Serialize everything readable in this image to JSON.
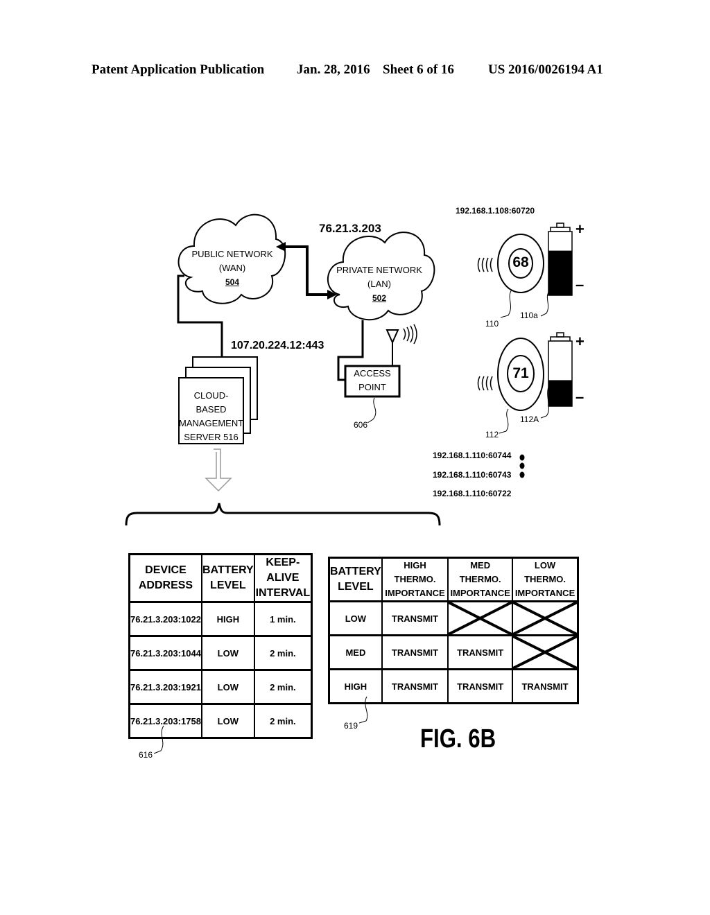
{
  "header": {
    "publication": "Patent Application Publication",
    "date": "Jan. 28, 2016",
    "sheet": "Sheet 6 of 16",
    "number": "US 2016/0026194 A1"
  },
  "diagram": {
    "public_network": {
      "line1": "PUBLIC NETWORK",
      "line2": "(WAN)",
      "ref": "504"
    },
    "private_network": {
      "line1": "PRIVATE NETWORK",
      "line2": "(LAN)",
      "ref": "502",
      "ip": "76.21.3.203"
    },
    "server": {
      "line1": "CLOUD-BASED",
      "line2": "MANAGEMENT",
      "line3": "SERVER 516",
      "ip": "107.20.224.12:443"
    },
    "access_point": {
      "line1": "ACCESS",
      "line2": "POINT",
      "ref": "606"
    },
    "thermostats": [
      {
        "address": "192.168.1.108:60720",
        "temperature": "68",
        "ref": "110",
        "battery_ref": "110a",
        "battery_level": 0.7
      },
      {
        "address": "",
        "temperature": "71",
        "ref": "112",
        "battery_ref": "112A",
        "battery_level": 0.4
      }
    ],
    "addresses": [
      "192.168.1.110:60744",
      "192.168.1.110:60743",
      "192.168.1.110:60722"
    ],
    "battery_plus": "+",
    "battery_minus": "–"
  },
  "table_616": {
    "ref": "616",
    "headers": [
      [
        "DEVICE",
        "ADDRESS"
      ],
      [
        "BATTERY",
        "LEVEL"
      ],
      [
        "KEEP-ALIVE",
        "INTERVAL"
      ]
    ],
    "rows": [
      [
        "76.21.3.203:1022",
        "HIGH",
        "1 min."
      ],
      [
        "76.21.3.203:1044",
        "LOW",
        "2 min."
      ],
      [
        "76.21.3.203:1921",
        "LOW",
        "2 min."
      ],
      [
        "76.21.3.203:1758",
        "LOW",
        "2 min."
      ]
    ]
  },
  "table_619": {
    "ref": "619",
    "headers": [
      [
        "BATTERY",
        "LEVEL"
      ],
      [
        "HIGH THERMO.",
        "IMPORTANCE"
      ],
      [
        "MED THERMO.",
        "IMPORTANCE"
      ],
      [
        "LOW THERMO.",
        "IMPORTANCE"
      ]
    ],
    "rows": [
      [
        "LOW",
        "TRANSMIT",
        "X",
        "X"
      ],
      [
        "MED",
        "TRANSMIT",
        "TRANSMIT",
        "X"
      ],
      [
        "HIGH",
        "TRANSMIT",
        "TRANSMIT",
        "TRANSMIT"
      ]
    ]
  },
  "figure_label": "FIG. 6B"
}
